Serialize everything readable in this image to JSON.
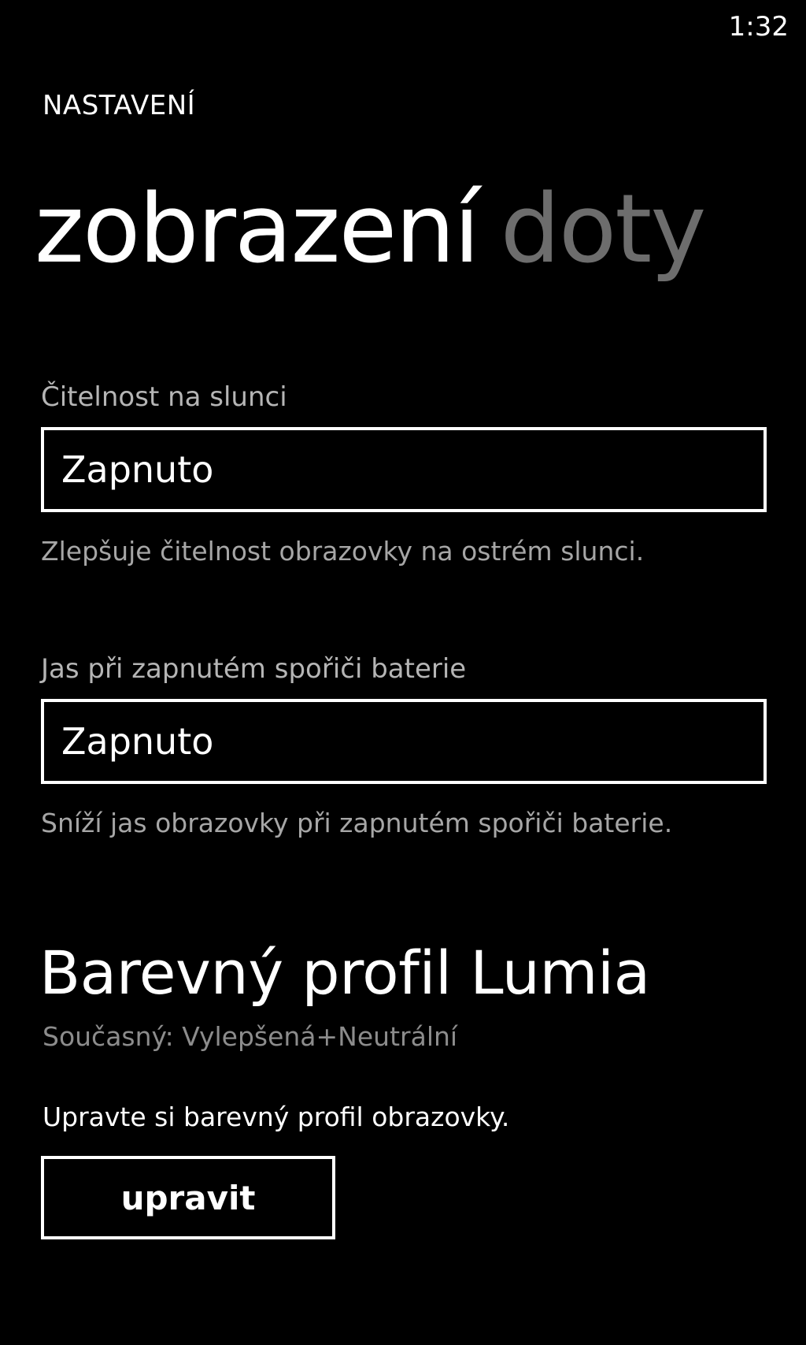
{
  "status_bar": {
    "time": "1:32"
  },
  "app": {
    "title": "NASTAVENÍ"
  },
  "pivot": {
    "active": "zobrazení",
    "next_partial": "doty"
  },
  "sunlight": {
    "label": "Čitelnost na slunci",
    "value": "Zapnuto",
    "description": "Zlepšuje čitelnost obrazovky na ostrém slunci."
  },
  "battery_saver": {
    "label": "Jas při zapnutém spořiči baterie",
    "value": "Zapnuto",
    "description": "Sníží jas obrazovky při zapnutém spořiči baterie."
  },
  "color_profile": {
    "heading": "Barevný profil Lumia",
    "current": "Současný: Vylepšená+Neutrální",
    "description": "Upravte si barevný profil obrazovky.",
    "button_label": "upravit"
  },
  "colors": {
    "background": "#000000",
    "foreground": "#ffffff",
    "inactive_pivot": "#6d6d6d",
    "secondary_text": "#a6a6a6"
  }
}
